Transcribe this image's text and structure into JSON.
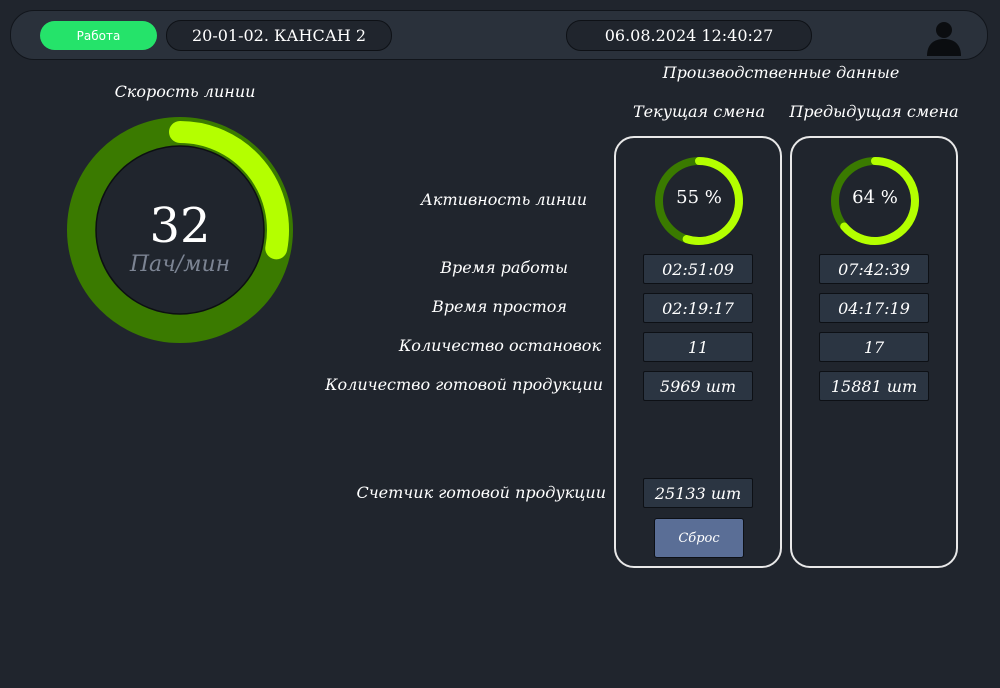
{
  "header": {
    "status": "Работа",
    "line_name": "20-01-02. КАНСАН 2",
    "datetime": "06.08.2024 12:40:27"
  },
  "speed": {
    "title": "Скорость линии",
    "value": "32",
    "unit": "Пач/мин",
    "fill_fraction": 0.28
  },
  "production": {
    "title": "Производственные  данные",
    "current_label": "Текущая смена",
    "previous_label": "Предыдущая смена",
    "rows": {
      "activity": "Активность линии",
      "work_time": "Время работы",
      "idle_time": "Время простоя",
      "stops": "Количество остановок",
      "finished": "Количество готовой продукции",
      "counter": "Счетчик готовой продукции"
    },
    "current": {
      "activity_text": "55 %",
      "activity_value": 0.55,
      "work_time": "02:51:09",
      "idle_time": "02:19:17",
      "stops": "11",
      "finished": "5969 шт",
      "counter": "25133 шт"
    },
    "previous": {
      "activity_text": "64 %",
      "activity_value": 0.64,
      "work_time": "07:42:39",
      "idle_time": "04:17:19",
      "stops": "17",
      "finished": "15881 шт"
    },
    "reset_label": "Сброс"
  },
  "colors": {
    "accent": "#b4ff00",
    "track": "#3a7a00",
    "status": "#25e36a",
    "background": "#20252d"
  },
  "icons": {
    "avatar": "user-avatar-icon"
  }
}
